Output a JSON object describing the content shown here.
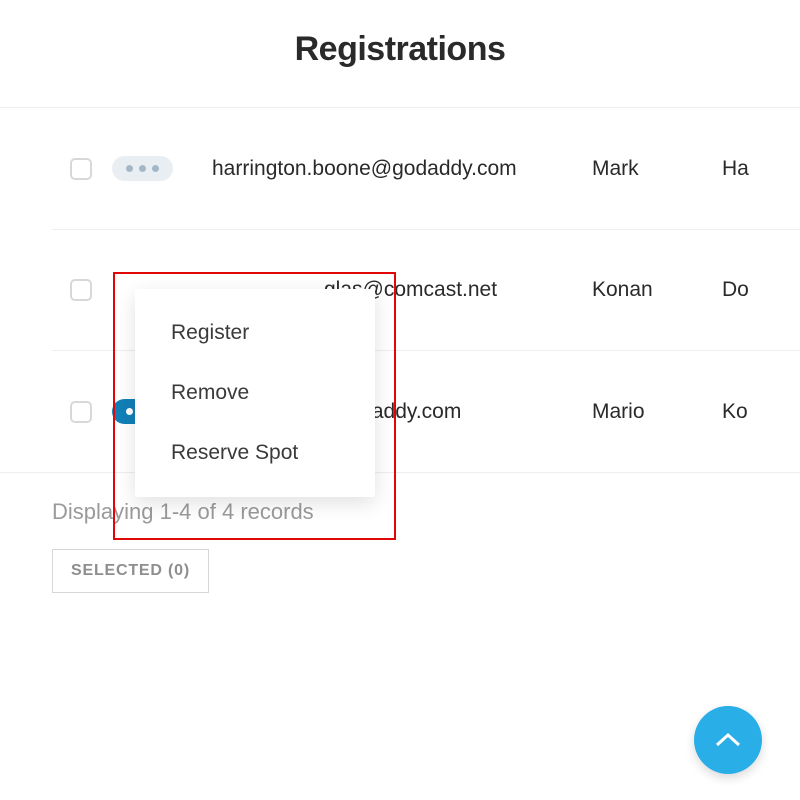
{
  "page_title": "Registrations",
  "rows": [
    {
      "email": "harrington.boone@godaddy.com",
      "first_name": "Mark",
      "last_name_fragment": "Ha",
      "menu_open": false
    },
    {
      "email": "glas@comcast.net",
      "first_name": "Konan",
      "last_name_fragment": "Do",
      "menu_open": false
    },
    {
      "email": "mario.kopff@godaddy.com",
      "first_name": "Mario",
      "last_name_fragment": "Ko",
      "menu_open": true
    }
  ],
  "dropdown": {
    "items": [
      "Register",
      "Remove",
      "Reserve Spot"
    ]
  },
  "footer": {
    "records_text": "Displaying 1-4 of 4 records",
    "selected_label": "SELECTED (0)"
  }
}
